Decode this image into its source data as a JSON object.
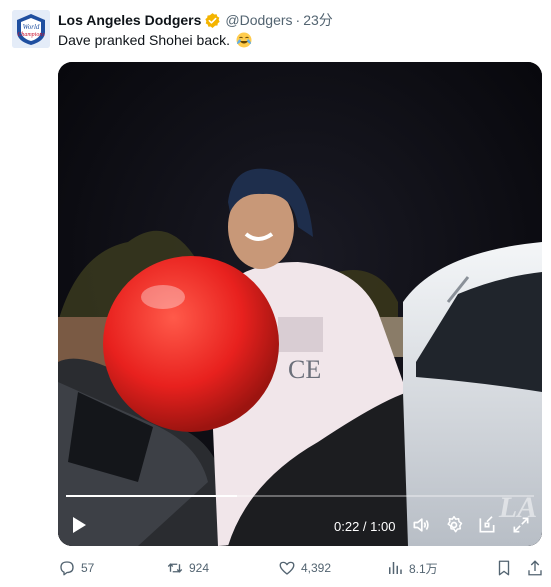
{
  "post": {
    "author_name": "Los Angeles Dodgers",
    "handle": "@Dodgers",
    "separator": "·",
    "time": "23分",
    "text": "Dave pranked Shohei back.",
    "avatar_label": "World Series Champions"
  },
  "video": {
    "current_time": "0:22",
    "time_separator": " / ",
    "duration": "1:00",
    "progress": 0.365,
    "watermark": "LA"
  },
  "actions": {
    "replies": "57",
    "reposts": "924",
    "likes": "4,392",
    "views": "8.1万"
  },
  "colors": {
    "verified_badge": "#f4b400",
    "secondary_text": "#536471",
    "balloon": "#e8211e"
  }
}
